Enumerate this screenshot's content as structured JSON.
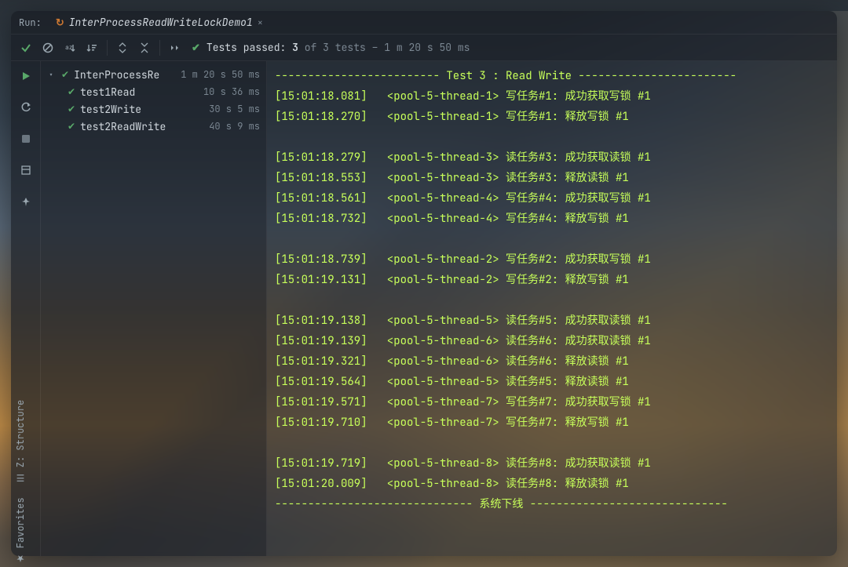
{
  "run": {
    "label": "Run:",
    "config_name": "InterProcessReadWriteLockDemo1"
  },
  "toolbar": {
    "show_passed_icon": "check",
    "disable_icon": "no-entry",
    "sort_icon": "sort-az",
    "sort_time_icon": "sort-time",
    "expand_icon": "expand-all",
    "collapse_icon": "collapse-all",
    "more_icon": "more"
  },
  "status": {
    "prefix": "Tests passed:",
    "passed_count": "3",
    "of_word": "of",
    "total_count": "3",
    "tests_word": "tests",
    "dash": "–",
    "duration": "1 m 20 s 50 ms"
  },
  "gutter": {
    "run": "run-icon",
    "rerun": "rerun-icon",
    "stop": "stop-icon",
    "layout": "layout-icon",
    "pin": "pin-icon"
  },
  "sidebar": {
    "structure": "Z: Structure",
    "favorites": "Favorites"
  },
  "tree": {
    "root": {
      "name": "InterProcessRe",
      "time": "1 m 20 s 50 ms"
    },
    "children": [
      {
        "name": "test1Read",
        "time": "10 s 36 ms"
      },
      {
        "name": "test2Write",
        "time": "30 s 5 ms"
      },
      {
        "name": "test2ReadWrite",
        "time": "40 s 9 ms"
      }
    ]
  },
  "console": {
    "lines": [
      "------------------------- Test 3 : Read Write ------------------------",
      "[15:01:18.081]   <pool-5-thread-1> 写任务#1: 成功获取写锁 #1",
      "[15:01:18.270]   <pool-5-thread-1> 写任务#1: 释放写锁 #1",
      "",
      "[15:01:18.279]   <pool-5-thread-3> 读任务#3: 成功获取读锁 #1",
      "[15:01:18.553]   <pool-5-thread-3> 读任务#3: 释放读锁 #1",
      "[15:01:18.561]   <pool-5-thread-4> 写任务#4: 成功获取写锁 #1",
      "[15:01:18.732]   <pool-5-thread-4> 写任务#4: 释放写锁 #1",
      "",
      "[15:01:18.739]   <pool-5-thread-2> 写任务#2: 成功获取写锁 #1",
      "[15:01:19.131]   <pool-5-thread-2> 写任务#2: 释放写锁 #1",
      "",
      "[15:01:19.138]   <pool-5-thread-5> 读任务#5: 成功获取读锁 #1",
      "[15:01:19.139]   <pool-5-thread-6> 读任务#6: 成功获取读锁 #1",
      "[15:01:19.321]   <pool-5-thread-6> 读任务#6: 释放读锁 #1",
      "[15:01:19.564]   <pool-5-thread-5> 读任务#5: 释放读锁 #1",
      "[15:01:19.571]   <pool-5-thread-7> 写任务#7: 成功获取写锁 #1",
      "[15:01:19.710]   <pool-5-thread-7> 写任务#7: 释放写锁 #1",
      "",
      "[15:01:19.719]   <pool-5-thread-8> 读任务#8: 成功获取读锁 #1",
      "[15:01:20.009]   <pool-5-thread-8> 读任务#8: 释放读锁 #1",
      "------------------------------ 系统下线 ------------------------------"
    ]
  }
}
